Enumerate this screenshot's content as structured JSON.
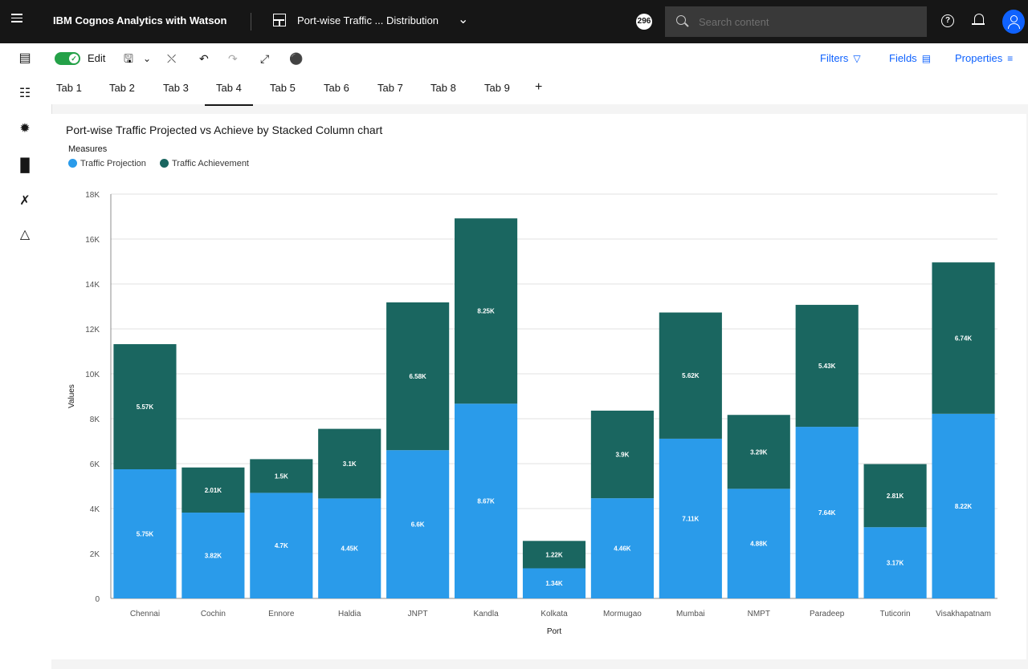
{
  "topbar": {
    "app_name": "IBM Cognos Analytics with Watson",
    "dashboard_title": "Port-wise Traffic ... Distribution",
    "notification_count": "296",
    "search_placeholder": "Search content"
  },
  "toolbar": {
    "edit_label": "Edit",
    "filters_label": "Filters",
    "fields_label": "Fields",
    "properties_label": "Properties"
  },
  "tabs": [
    {
      "label": "Tab 1",
      "active": false
    },
    {
      "label": "Tab 2",
      "active": false
    },
    {
      "label": "Tab 3",
      "active": false
    },
    {
      "label": "Tab 4",
      "active": true
    },
    {
      "label": "Tab 5",
      "active": false
    },
    {
      "label": "Tab 6",
      "active": false
    },
    {
      "label": "Tab 7",
      "active": false
    },
    {
      "label": "Tab 8",
      "active": false
    },
    {
      "label": "Tab 9",
      "active": false
    }
  ],
  "chart_data": {
    "type": "bar",
    "stacked": true,
    "title": "Port-wise Traffic Projected vs Achieve by Stacked Column chart",
    "legend_title": "Measures",
    "legend_position": "top-left",
    "xlabel": "Port",
    "ylabel": "Values",
    "ylim": [
      0,
      18000
    ],
    "yticks": [
      "0",
      "2K",
      "4K",
      "6K",
      "8K",
      "10K",
      "12K",
      "14K",
      "16K",
      "18K"
    ],
    "ytick_values": [
      0,
      2000,
      4000,
      6000,
      8000,
      10000,
      12000,
      14000,
      16000,
      18000
    ],
    "grid": true,
    "categories": [
      "Chennai",
      "Cochin",
      "Ennore",
      "Haldia",
      "JNPT",
      "Kandla",
      "Kolkata",
      "Mormugao",
      "Mumbai",
      "NMPT",
      "Paradeep",
      "Tuticorin",
      "Visakhapatnam"
    ],
    "series": [
      {
        "name": "Traffic Projection",
        "color": "#2a9bea",
        "values": [
          5750,
          3820,
          4700,
          4450,
          6600,
          8670,
          1340,
          4460,
          7110,
          4880,
          7640,
          3170,
          8220
        ],
        "labels": [
          "5.75K",
          "3.82K",
          "4.7K",
          "4.45K",
          "6.6K",
          "8.67K",
          "1.34K",
          "4.46K",
          "7.11K",
          "4.88K",
          "7.64K",
          "3.17K",
          "8.22K"
        ]
      },
      {
        "name": "Traffic Achievement",
        "color": "#1a6660",
        "values": [
          5570,
          2010,
          1500,
          3100,
          6580,
          8250,
          1220,
          3900,
          5620,
          3290,
          5430,
          2810,
          6740
        ],
        "labels": [
          "5.57K",
          "2.01K",
          "1.5K",
          "3.1K",
          "6.58K",
          "8.25K",
          "1.22K",
          "3.9K",
          "5.62K",
          "3.29K",
          "5.43K",
          "2.81K",
          "6.74K"
        ]
      }
    ]
  }
}
